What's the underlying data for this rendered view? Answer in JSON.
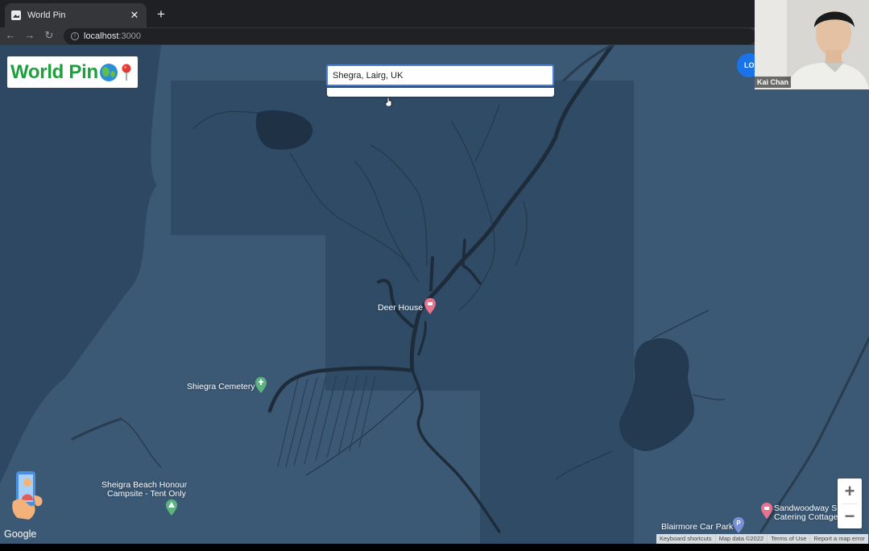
{
  "browser": {
    "tab_title": "World Pin",
    "url_host": "localhost",
    "url_port": ":3000"
  },
  "app": {
    "logo_text": "World Pin"
  },
  "search": {
    "value": "Shegra, Lairg, UK"
  },
  "map": {
    "labels": {
      "deer_house": "Deer House",
      "cemetery": "Shiegra Cemetery",
      "campsite_line1": "Sheigra Beach Honour",
      "campsite_line2": "Campsite - Tent Only",
      "car_park": "Blairmore Car Park",
      "cottage_line1": "Sandwoodway S",
      "cottage_line2": "Catering Cottage"
    },
    "zoom_in": "+",
    "zoom_out": "−",
    "google": "Google",
    "attribution": {
      "keyboard": "Keyboard shortcuts",
      "map_data": "Map data ©2022",
      "terms": "Terms of Use",
      "report": "Report a map error"
    }
  },
  "overlay": {
    "user_button": "LO",
    "cam_name": "Kai Chan"
  },
  "colors": {
    "map_bg": "#3b5874",
    "region": "#2f4b66",
    "road": "#1e2c3a",
    "logo_green": "#1e9e3c",
    "poi_pink": "#e8738e",
    "poi_green": "#5bb37f",
    "poi_blue": "#7b8fd6"
  },
  "icons": [
    "tab-favicon-icon",
    "close-icon",
    "plus-icon",
    "back-icon",
    "forward-icon",
    "reload-icon",
    "info-icon",
    "location-icon",
    "globe-icon",
    "pin-icon",
    "pegman-icon",
    "poi-pin-icon",
    "cemetery-icon",
    "campsite-icon",
    "parking-icon"
  ]
}
